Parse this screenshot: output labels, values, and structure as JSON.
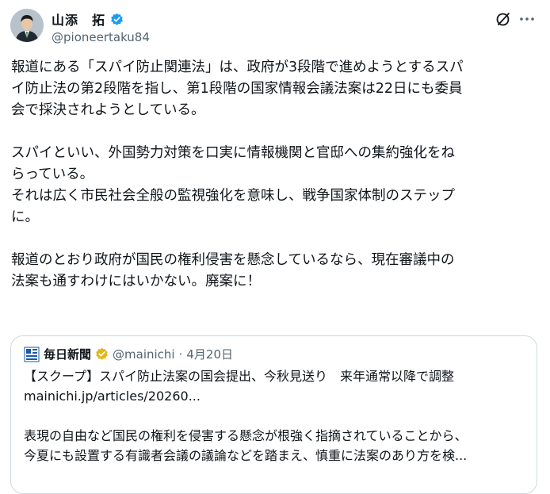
{
  "author": {
    "display_name": "山添　拓",
    "handle": "@pioneertaku84"
  },
  "post": {
    "paragraphs": [
      [
        "報道にある「スパイ防止関連法」は、政府が3段階で進めようとするスパ",
        "イ防止法の第2段階を指し、第1段階の国家情報会議法案は22日にも委員",
        "会で採決されようとしている。"
      ],
      [
        "スパイといい、外国勢力対策を口実に情報機関と官邸への集約強化をね",
        "らっている。",
        "それは広く市民社会全般の監視強化を意味し、戦争国家体制のステップ",
        "に。"
      ],
      [
        "報道のとおり政府が国民の権利侵害を懸念しているなら、現在審議中の",
        "法案も通すわけにはいかない。廃案に！"
      ]
    ]
  },
  "quote": {
    "name": "毎日新聞",
    "handle": "@mainichi",
    "separator": "·",
    "date": "4月20日",
    "headline": "【スクープ】スパイ防止法案の国会提出、今秋見送り　来年通常以降で調整",
    "link": "mainichi.jp/articles/20260...",
    "excerpt": [
      "表現の自由など国民の権利を侵害する懸念が根強く指摘されていることから、",
      "今夏にも設置する有識者会議の議論などを踏まえ、慎重に法案のあり方を検..."
    ]
  },
  "icons": {
    "verified": "verified-badge-icon",
    "grok": "grok-icon",
    "more": "more-icon"
  },
  "colors": {
    "text": "#0f1419",
    "secondary": "#536471",
    "verified_blue": "#1d9bf0",
    "verified_gold": "#e2b719",
    "border": "#cfd9de",
    "mainichi_blue": "#1a5aa8"
  }
}
